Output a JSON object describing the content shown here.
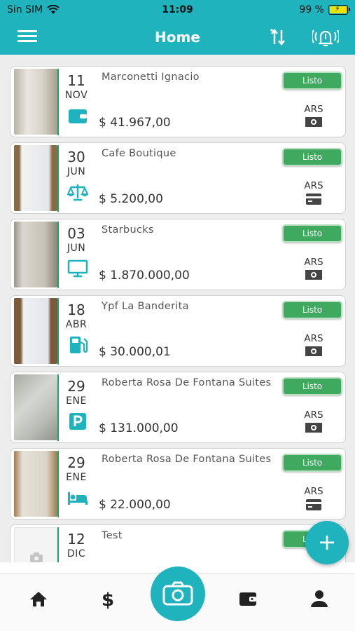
{
  "status_bar": {
    "carrier": "Sin SIM",
    "time": "11:09",
    "battery": "99 %"
  },
  "app_bar": {
    "title": "Home"
  },
  "receipts": [
    {
      "day": "11",
      "month": "NOV",
      "merchant": "Marconetti Ignacio",
      "amount": "$ 41.967,00",
      "status": "Listo",
      "currency": "ARS",
      "category_icon": "wallet-icon",
      "payment_icon": "cash-icon"
    },
    {
      "day": "30",
      "month": "JUN",
      "merchant": "Cafe Boutique",
      "amount": "$ 5.200,00",
      "status": "Listo",
      "currency": "ARS",
      "category_icon": "scale-icon",
      "payment_icon": "card-icon"
    },
    {
      "day": "03",
      "month": "JUN",
      "merchant": "Starbucks",
      "amount": "$ 1.870.000,00",
      "status": "Listo",
      "currency": "ARS",
      "category_icon": "monitor-icon",
      "payment_icon": "cash-icon"
    },
    {
      "day": "18",
      "month": "ABR",
      "merchant": "Ypf La Banderita",
      "amount": "$ 30.000,01",
      "status": "Listo",
      "currency": "ARS",
      "category_icon": "fuel-icon",
      "payment_icon": "cash-icon"
    },
    {
      "day": "29",
      "month": "ENE",
      "merchant": "Roberta Rosa De Fontana Suites",
      "amount": "$ 131.000,00",
      "status": "Listo",
      "currency": "ARS",
      "category_icon": "parking-icon",
      "payment_icon": "cash-icon"
    },
    {
      "day": "29",
      "month": "ENE",
      "merchant": "Roberta Rosa De Fontana Suites",
      "amount": "$ 22.000,00",
      "status": "Listo",
      "currency": "ARS",
      "category_icon": "bed-icon",
      "payment_icon": "card-icon"
    },
    {
      "day": "12",
      "month": "DIC",
      "merchant": "Test",
      "amount": "",
      "status": "Listo",
      "currency": "",
      "category_icon": "",
      "payment_icon": ""
    }
  ],
  "fab": {
    "label": "+"
  },
  "colors": {
    "primary": "#1eb3bd",
    "status_green": "#3ea95f",
    "divider_green": "#20a36b",
    "icon": "#1eb3bd"
  },
  "bottom_nav": [
    "home-icon",
    "dollar-icon",
    "camera-icon",
    "wallet-icon",
    "user-icon"
  ]
}
